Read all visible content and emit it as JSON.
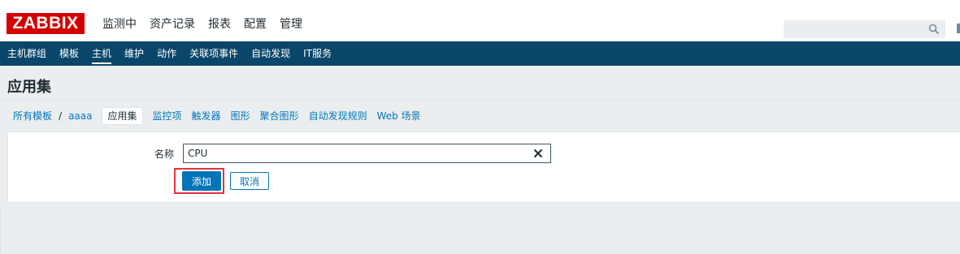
{
  "logo": "ZABBIX",
  "top_menu": [
    {
      "label": "监测中"
    },
    {
      "label": "资产记录"
    },
    {
      "label": "报表"
    },
    {
      "label": "配置"
    },
    {
      "label": "管理"
    }
  ],
  "top_menu_active": "配置",
  "search": {
    "placeholder": "",
    "value": "",
    "icon": "search-icon"
  },
  "sub_menu": [
    {
      "label": "主机群组"
    },
    {
      "label": "模板"
    },
    {
      "label": "主机"
    },
    {
      "label": "维护"
    },
    {
      "label": "动作"
    },
    {
      "label": "关联项事件"
    },
    {
      "label": "自动发现"
    },
    {
      "label": "IT服务"
    }
  ],
  "sub_menu_active": "主机",
  "page_title": "应用集",
  "breadcrumb": {
    "root": "所有模板",
    "separator": "/",
    "template": "aaaa"
  },
  "tabs": [
    {
      "label": "应用集"
    },
    {
      "label": "监控项"
    },
    {
      "label": "触发器"
    },
    {
      "label": "图形"
    },
    {
      "label": "聚合图形"
    },
    {
      "label": "自动发现规则"
    },
    {
      "label": "Web 场景"
    }
  ],
  "tabs_active": "应用集",
  "form": {
    "name_label": "名称",
    "name_value": "CPU",
    "clear_icon": "close-icon",
    "add_label": "添加",
    "cancel_label": "取消"
  },
  "colors": {
    "brand_red": "#d40000",
    "nav_blue": "#0a466a",
    "link_blue": "#0275b8",
    "highlight_red": "#e0343a",
    "page_bg": "#ebeef0"
  }
}
